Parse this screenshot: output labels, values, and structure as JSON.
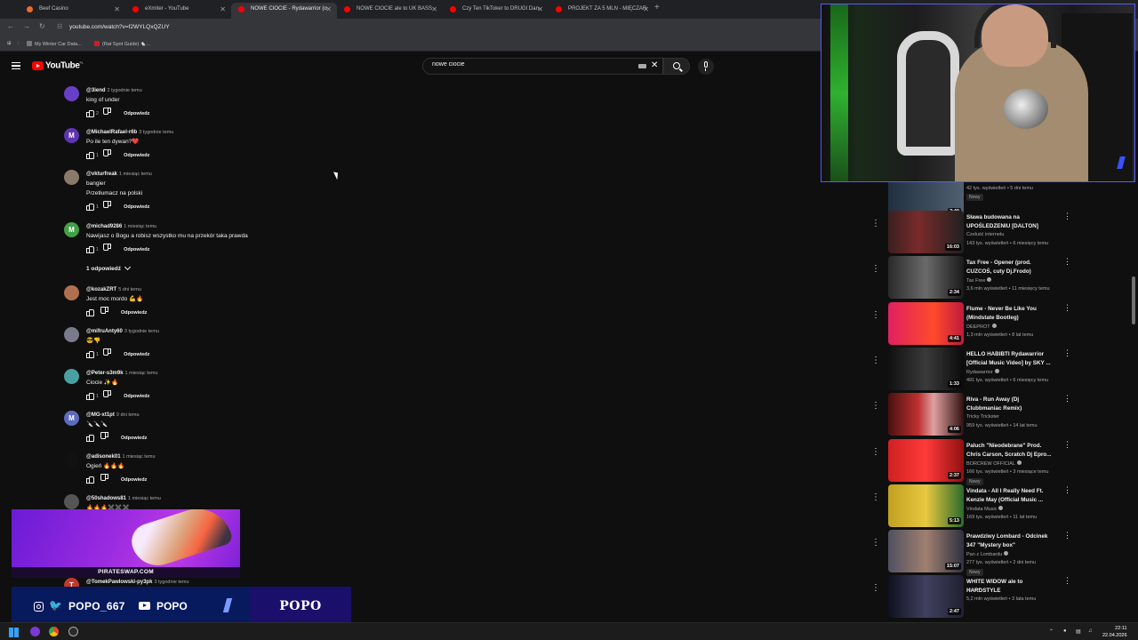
{
  "browser": {
    "tabs": [
      {
        "label": "Beef Casino",
        "fav": "#f06a2a"
      },
      {
        "label": "eXmiter - YouTube",
        "fav": "#ff0000"
      },
      {
        "label": "NOWE CIOCIE - Rydawarrior (o",
        "fav": "#ff0000",
        "active": true
      },
      {
        "label": "NOWE CIOCIE ale to UK BASS",
        "fav": "#ff0000"
      },
      {
        "label": "Czy Ten TikToker to DRUGI Dan",
        "fav": "#ff0000"
      },
      {
        "label": "PROJEKT ZA 5 MLN - MIĘCZAR",
        "fav": "#ff0000"
      }
    ],
    "new_tab": "+",
    "url": "youtube.com/watch?v=f2WYLQxQZUY",
    "bookmarks": [
      {
        "label": "My Winter Car Data...",
        "color": "#777777"
      },
      {
        "label": "(Rat Spot Guide) 🐁...",
        "color": "#d11a2a"
      }
    ]
  },
  "youtube": {
    "logo": "YouTube",
    "logo_sup": "PL",
    "search_value": "nowe ciocie",
    "search_placeholder": "Szukaj"
  },
  "comments": [
    {
      "author": "@3iend",
      "time": "2 tygodnie temu",
      "lines": [
        "king of under"
      ],
      "likes": "2",
      "reply": "Odpowiedz",
      "avatar_color": "#6a3fc8",
      "avatar_letter": ""
    },
    {
      "author": "@MichaelRafael-r6b",
      "time": "3 tygodnie temu",
      "lines": [
        "Po ile ten dywan?❤️"
      ],
      "likes": "1",
      "reply": "Odpowiedz",
      "avatar_color": "#5e35b1",
      "avatar_letter": "M"
    },
    {
      "author": "@vkturfreak",
      "time": "1 miesiąc temu",
      "lines": [
        "bangier",
        "Przetłumacz na polski"
      ],
      "likes": "1",
      "reply": "Odpowiedz",
      "avatar_color": "#8a7a6a",
      "avatar_letter": ""
    },
    {
      "author": "@michad9286",
      "time": "1 miesiąc temu",
      "lines": [
        "Nawijasz o Bogu a robisz wszystko mu na przekór taka prawda"
      ],
      "likes": "1",
      "reply": "Odpowiedz",
      "avatar_color": "#43a047",
      "avatar_letter": "M"
    },
    {
      "author": "@kozakZRT",
      "time": "5 dni temu",
      "lines": [
        "Jest moc mordo 💪🔥"
      ],
      "likes": "",
      "reply": "Odpowiedz",
      "avatar_color": "#b07050",
      "avatar_letter": ""
    },
    {
      "author": "@mifruAnty60",
      "time": "3 tygodnie temu",
      "lines": [
        "😎👎"
      ],
      "likes": "1",
      "reply": "Odpowiedz",
      "avatar_color": "#7a7a8a",
      "avatar_letter": ""
    },
    {
      "author": "@Peter-s3m9k",
      "time": "1 miesiąc temu",
      "lines": [
        "Ciocie ✨🔥"
      ],
      "likes": "1",
      "reply": "Odpowiedz",
      "avatar_color": "#4aa0a0",
      "avatar_letter": ""
    },
    {
      "author": "@MG-xt1pt",
      "time": "9 dni temu",
      "lines": [
        "🔪🔪🔪"
      ],
      "likes": "",
      "reply": "Odpowiedz",
      "avatar_color": "#5c6bc0",
      "avatar_letter": "M"
    },
    {
      "author": "@adisonek01",
      "time": "1 miesiąc temu",
      "lines": [
        "Ogień 🔥🔥🔥"
      ],
      "likes": "",
      "reply": "Odpowiedz",
      "avatar_color": "#111111",
      "avatar_letter": ""
    },
    {
      "author": "@50shadows81",
      "time": "1 miesiąc temu",
      "lines": [
        "🔥🔥🔥✖️✖️✖️"
      ],
      "likes": "",
      "reply": "",
      "avatar_color": "#555555",
      "avatar_letter": ""
    },
    {
      "author": "@TomekPawlowski-py3pk",
      "time": "3 tygodnie temu",
      "lines": [],
      "likes": "",
      "reply": "",
      "avatar_color": "#c0392b",
      "avatar_letter": "T"
    }
  ],
  "replies_toggle": "1 odpowiedź",
  "related_partial": {
    "title": "BIG JEDI I DZIARMA",
    "meta": "42 tys. wyświetleń • 5 dni temu",
    "duration": "2:40",
    "badge": "Nowy"
  },
  "related": [
    {
      "title": "Sława budowana na UPOŚLEDZENIU [DALTON]",
      "channel": "Czeluść internetu",
      "meta": "143 tys. wyświetleń • 6 miesięcy temu",
      "duration": "16:03",
      "verified": false,
      "badge": "",
      "thumb": "linear-gradient(90deg,#3a2020,#7a2a2a 40%,#202020)"
    },
    {
      "title": "Tax Free - Opener (prod. CUZCOŚ, cuty Dj.Frodo)",
      "channel": "Tax Free",
      "meta": "3,6 mln wyświetleń • 11 miesięcy temu",
      "duration": "2:34",
      "verified": true,
      "badge": "",
      "thumb": "linear-gradient(90deg,#2a2a2a,#6a6a6a 50%,#1a1a1a)"
    },
    {
      "title": "Flume - Never Be Like You (Mindstate Bootleg)",
      "channel": "DEEPROT",
      "meta": "1,3 mln wyświetleń • 8 lat temu",
      "duration": "4:41",
      "verified": true,
      "badge": "",
      "thumb": "linear-gradient(90deg,#e02060,#ff4a2a 60%,#c01a40)"
    },
    {
      "title": "HELLO HABIBTI Rydawarrior [Official Music Video] by SKY ...",
      "channel": "Rydawarrior",
      "meta": "491 tys. wyświetleń • 6 miesięcy temu",
      "duration": "1:33",
      "verified": true,
      "badge": "",
      "thumb": "linear-gradient(90deg,#101010,#3a3a3a 50%,#0a0a0a)"
    },
    {
      "title": "Riva - Run Away (Dj Clubbmaniac Remix)",
      "channel": "Tricky Trickster",
      "meta": "959 tys. wyświetleń • 14 lat temu",
      "duration": "4:06",
      "verified": false,
      "badge": "",
      "thumb": "linear-gradient(90deg,#4a1010,#c03030 40%,#e0a0a0 60%,#301010)"
    },
    {
      "title": "Paluch \"Nieodebrane\" Prod. Chris Carson, Scratch Dj Epro...",
      "channel": "BORCREW OFFICIAL",
      "meta": "166 tys. wyświetleń • 3 miesiące temu",
      "duration": "2:37",
      "verified": true,
      "badge": "Nowy",
      "thumb": "linear-gradient(90deg,#d02020,#ff3a3a 50%,#901010)"
    },
    {
      "title": "Vindata - All I Really Need Ft. Kenzie May (Official Music ...",
      "channel": "Vindata Music",
      "meta": "169 tys. wyświetleń • 11 lat temu",
      "duration": "5:13",
      "verified": true,
      "badge": "",
      "thumb": "linear-gradient(90deg,#c0a020,#e8c840 50%,#2a6a2a)"
    },
    {
      "title": "Prawdziwy Lombard - Odcinek 347 \"Mystery box\"",
      "channel": "Pan z Lombardu",
      "meta": "277 tys. wyświetleń • 2 dni temu",
      "duration": "15:07",
      "verified": true,
      "badge": "Nowy",
      "thumb": "linear-gradient(90deg,#505060,#a08070 50%,#303040)"
    },
    {
      "title": "WHITE WIDOW ale to HARDSTYLE",
      "channel": "skeety",
      "meta": "5,2 mln wyświetleń • 3 lata temu",
      "duration": "2:47",
      "verified": false,
      "badge": "",
      "thumb": "linear-gradient(90deg,#101020,#404060 50%,#202030)"
    }
  ],
  "overlay": {
    "ad_text": "PIRATESWAP.COM",
    "handle1": "POPO_667",
    "handle2": "POPO",
    "brand": "POPO"
  },
  "taskbar": {
    "time": "22:11",
    "date": "22.04.2026"
  }
}
